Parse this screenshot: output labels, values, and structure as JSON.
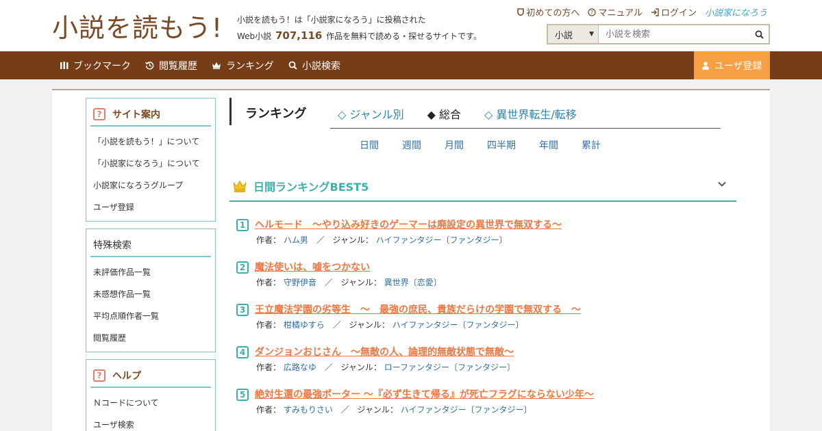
{
  "header": {
    "logo": "小説を読もう!",
    "tagline_line1": "小説を読もう！は「小説家になろう」に投稿された",
    "tagline_prefix": "Web小説",
    "tagline_count": "707,116",
    "tagline_suffix": "作品を無料で読める・探せるサイトです。",
    "links": {
      "first": "初めての方へ",
      "manual": "マニュアル",
      "login": "ログイン",
      "narou_logo": "小説家になろう"
    },
    "search": {
      "select_value": "小説",
      "placeholder": "小説を検索"
    }
  },
  "nav": {
    "bookmark": "ブックマーク",
    "history": "閲覧履歴",
    "ranking": "ランキング",
    "search": "小説検索",
    "register": "ユーザ登録"
  },
  "sidebar": {
    "site_guide": {
      "title": "サイト案内",
      "items": [
        "「小説を読もう！」について",
        "「小説家になろう」について",
        "小説家になろうグループ",
        "ユーザ登録"
      ]
    },
    "special_search": {
      "title": "特殊検索",
      "items": [
        "未評価作品一覧",
        "未感想作品一覧",
        "平均点順作者一覧",
        "閲覧履歴"
      ]
    },
    "help": {
      "title": "ヘルプ",
      "items": [
        "Ｎコードについて",
        "ユーザ検索"
      ]
    }
  },
  "ranking": {
    "title": "ランキング",
    "tabs": [
      "◇ ジャンル別",
      "◆ 総合",
      "◇ 異世界転生/転移"
    ],
    "periods": [
      "日間",
      "週間",
      "月間",
      "四半期",
      "年間",
      "累計"
    ],
    "best_title": "日間ランキングBEST5",
    "author_label": "作者：",
    "genre_label": "ジャンル：",
    "separator": "／",
    "items": [
      {
        "rank": "1",
        "title": "ヘルモード　～やり込み好きのゲーマーは廃設定の異世界で無双する～",
        "author": "ハム男",
        "genre": "ハイファンタジー〔ファンタジー〕"
      },
      {
        "rank": "2",
        "title": "魔法使いは、嘘をつかない",
        "author": "守野伊音",
        "genre": "異世界〔恋愛〕"
      },
      {
        "rank": "3",
        "title": "王立魔法学園の劣等生　～　最強の庶民、貴族だらけの学園で無双する　～",
        "author": "柑橘ゆすら",
        "genre": "ハイファンタジー〔ファンタジー〕"
      },
      {
        "rank": "4",
        "title": "ダンジョンおじさん　～無敵の人、論理的無敵状態で無敵～",
        "author": "広路なゆ",
        "genre": "ローファンタジー〔ファンタジー〕"
      },
      {
        "rank": "5",
        "title": "絶対生還の最強ポーター ～『必ず生きて帰る』が死亡フラグにならない少年～",
        "author": "すみもりさい",
        "genre": "ハイファンタジー〔ファンタジー〕"
      }
    ]
  }
}
